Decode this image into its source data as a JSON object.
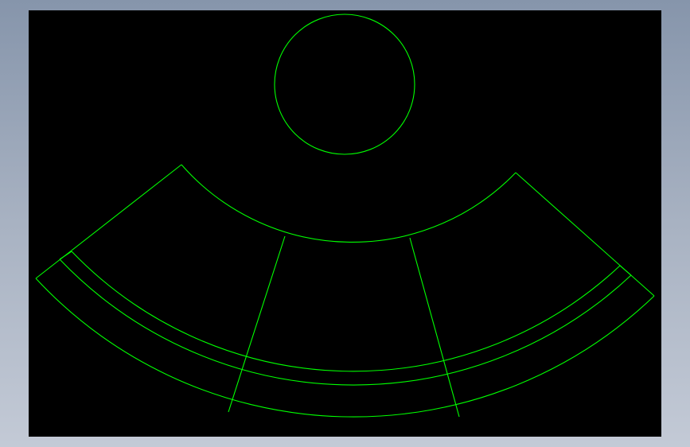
{
  "colors": {
    "background_top": "#8695ab",
    "background_bottom": "#c3cad6",
    "viewport": "#000000",
    "line": "#00ff00"
  },
  "drawing": {
    "entities": [
      {
        "name": "circle",
        "kind": "circle"
      },
      {
        "name": "inner-arc",
        "kind": "arc"
      },
      {
        "name": "middle-arc-1",
        "kind": "arc"
      },
      {
        "name": "middle-arc-2",
        "kind": "arc"
      },
      {
        "name": "outer-arc",
        "kind": "arc"
      },
      {
        "name": "left-side-edge",
        "kind": "line"
      },
      {
        "name": "right-side-edge",
        "kind": "line"
      },
      {
        "name": "left-inner-cap",
        "kind": "line"
      },
      {
        "name": "right-inner-cap",
        "kind": "line"
      },
      {
        "name": "left-divider",
        "kind": "line"
      },
      {
        "name": "right-divider",
        "kind": "line"
      }
    ]
  }
}
